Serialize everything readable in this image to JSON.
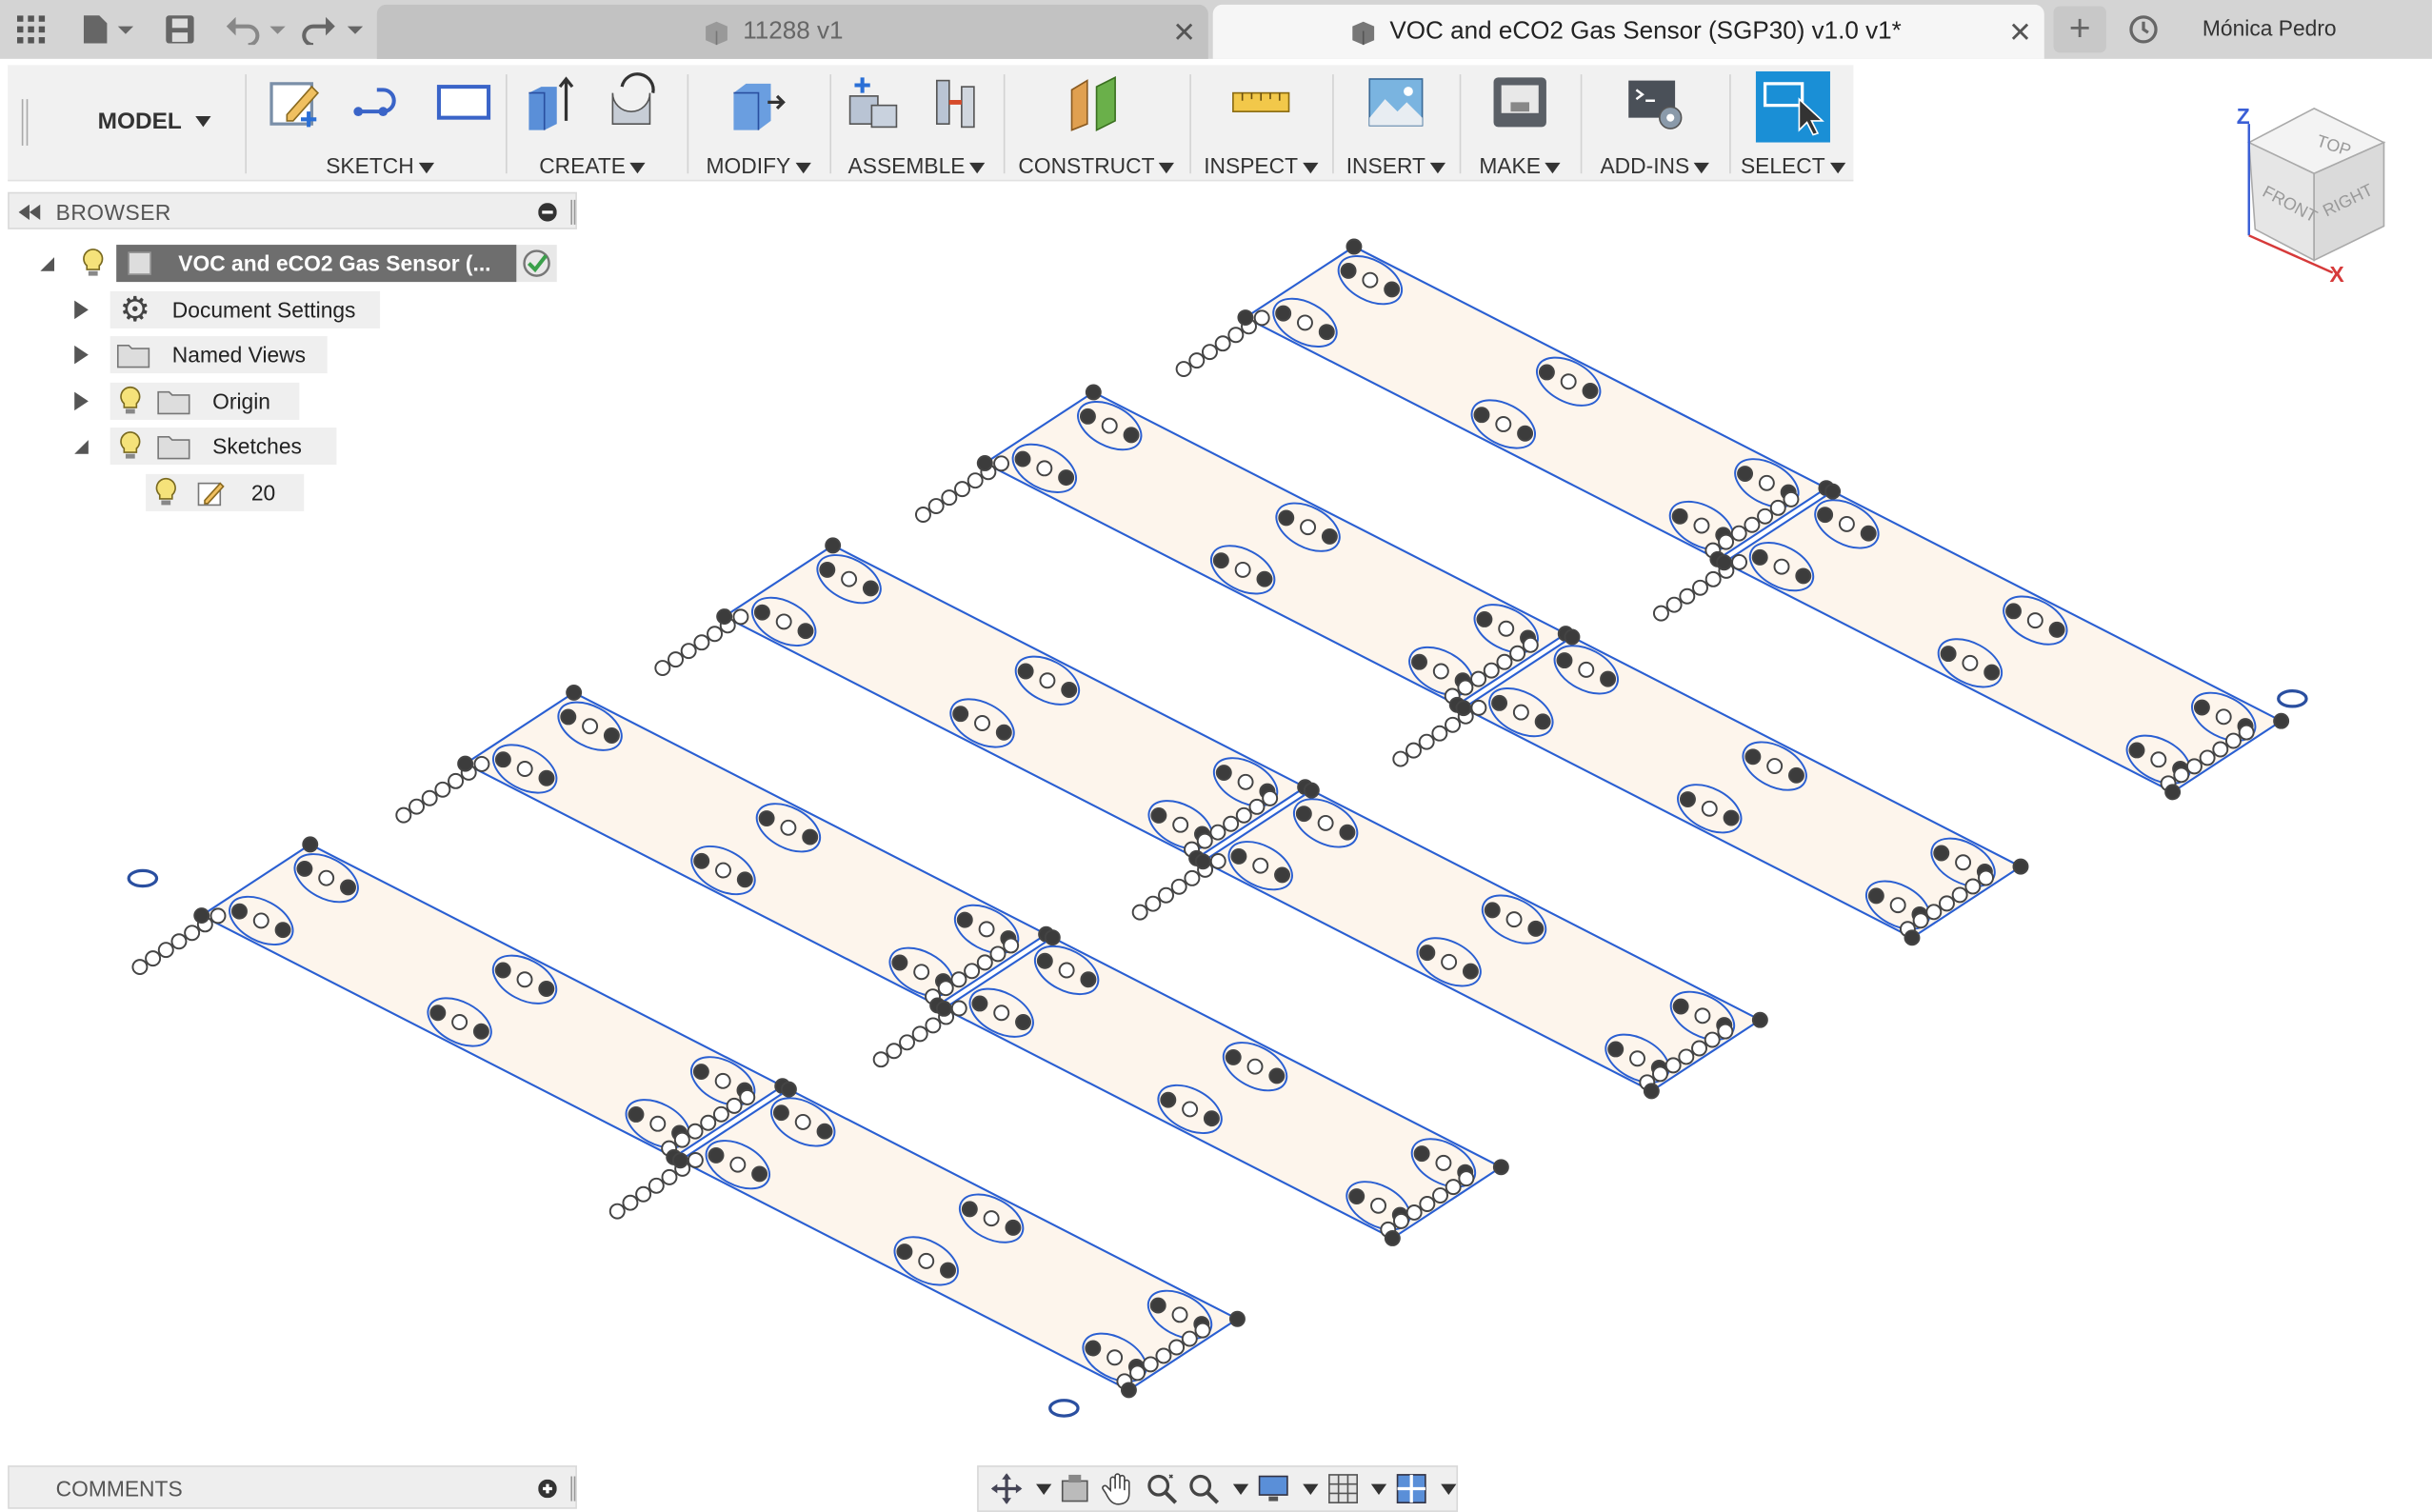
{
  "tabs": [
    {
      "label": "11288 v1"
    },
    {
      "label": "VOC and eCO2 Gas Sensor (SGP30) v1.0 v1*"
    }
  ],
  "user": {
    "name": "Mónica Pedro"
  },
  "workspace": {
    "label": "MODEL"
  },
  "toolbar": {
    "sketch": "SKETCH",
    "create": "CREATE",
    "modify": "MODIFY",
    "assemble": "ASSEMBLE",
    "construct": "CONSTRUCT",
    "inspect": "INSPECT",
    "insert": "INSERT",
    "make": "MAKE",
    "addins": "ADD-INS",
    "select": "SELECT"
  },
  "browser": {
    "title": "BROWSER",
    "root": "VOC and eCO2 Gas Sensor (...",
    "items": [
      {
        "label": "Document Settings"
      },
      {
        "label": "Named Views"
      },
      {
        "label": "Origin"
      },
      {
        "label": "Sketches"
      }
    ],
    "sketch_child": "20"
  },
  "viewcube": {
    "top": "TOP",
    "front": "FRONT",
    "right": "RIGHT",
    "x": "X",
    "z": "Z"
  },
  "comments": {
    "title": "COMMENTS"
  },
  "colors": {
    "accent": "#1a8fd6",
    "panel_fill": "#fdf5ec",
    "sketch_line": "#2a5fd2"
  }
}
